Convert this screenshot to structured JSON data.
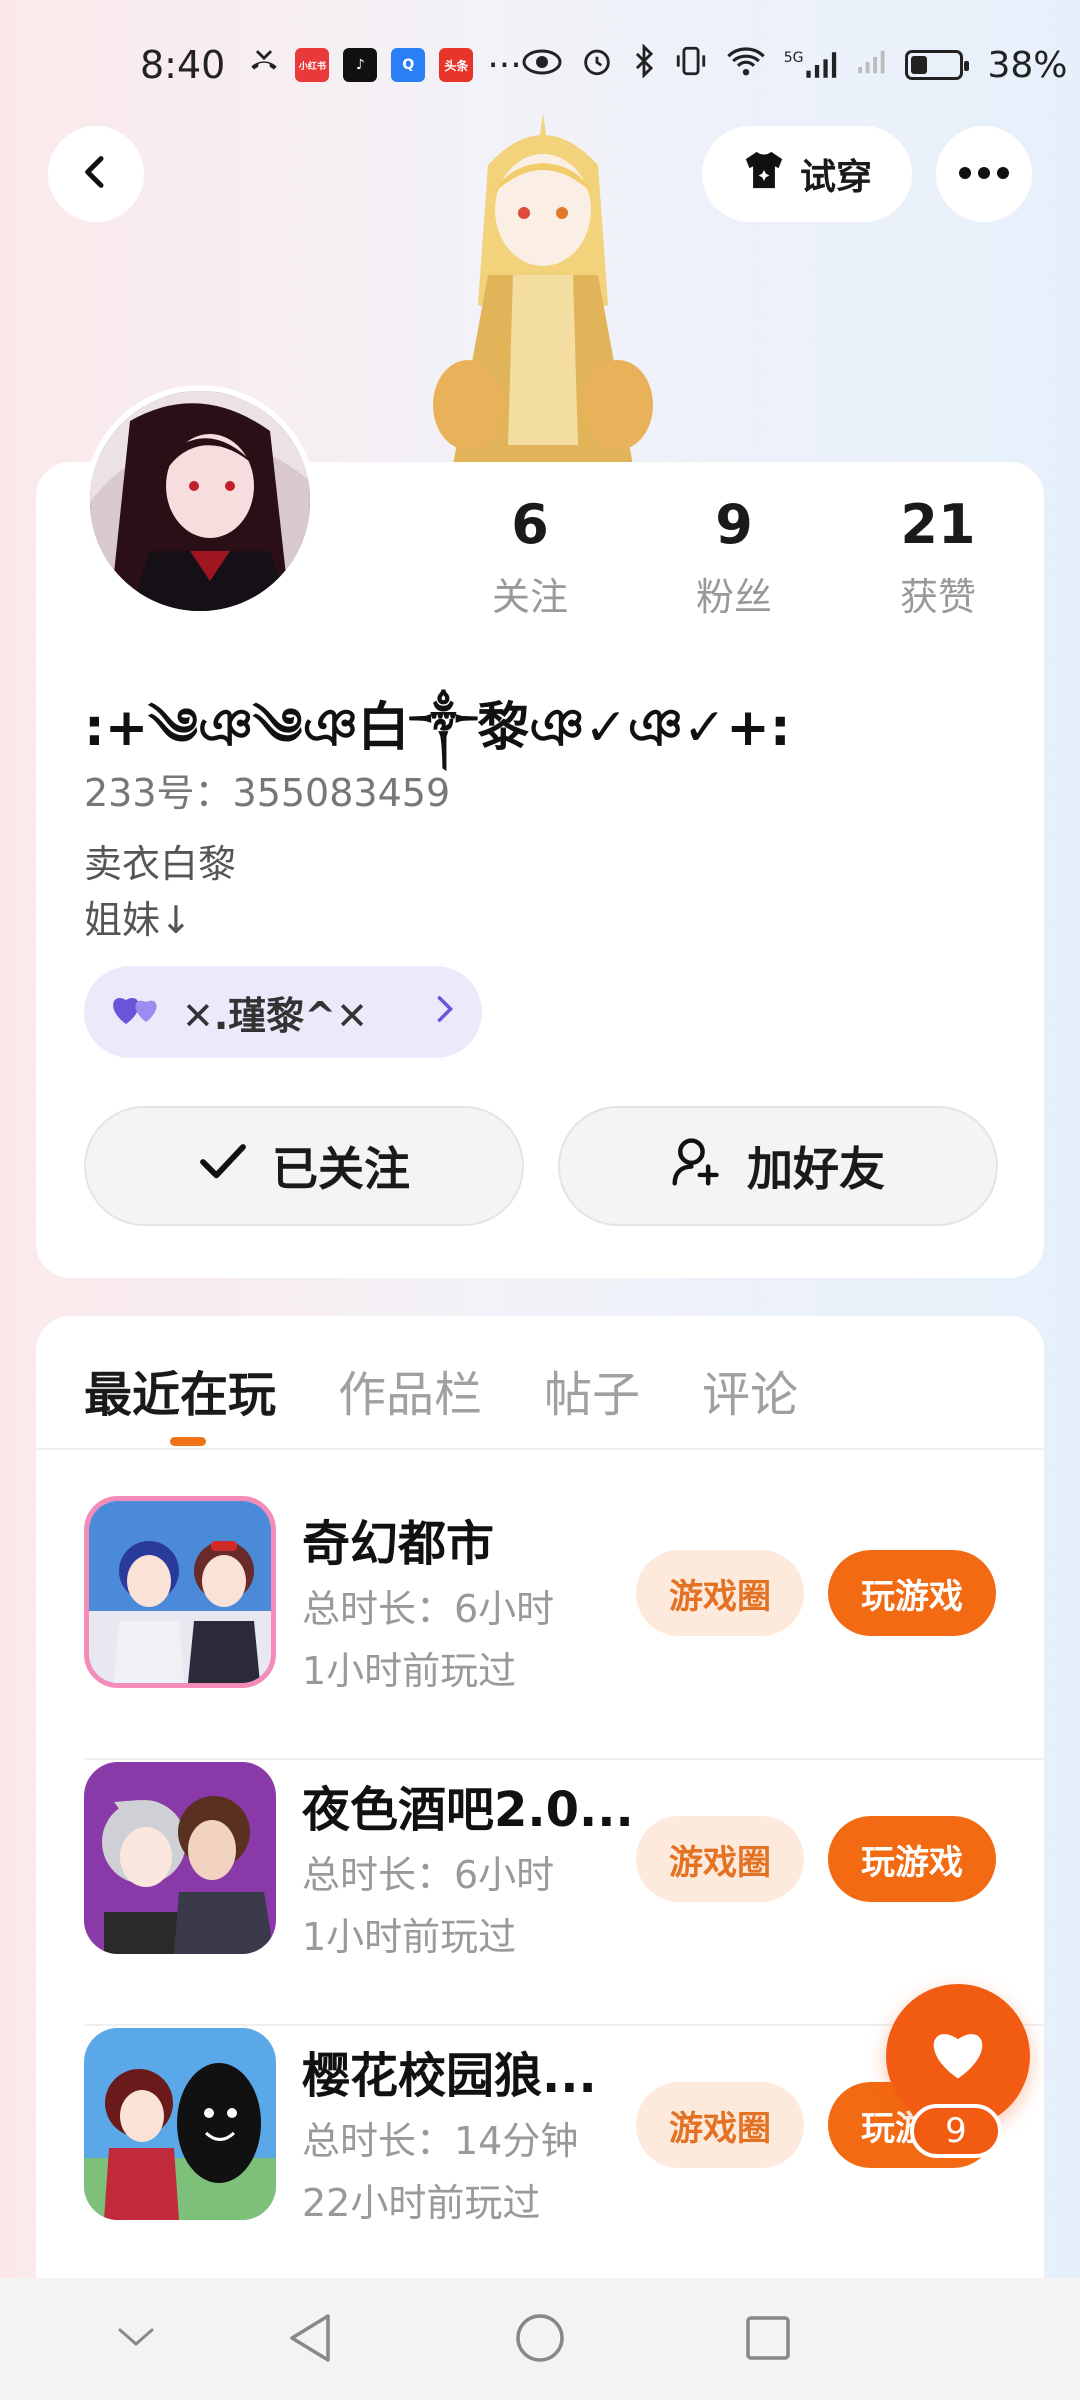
{
  "status_bar": {
    "time": "8:40",
    "more": "···",
    "network": "5G",
    "battery": "38%",
    "notif_icons": [
      {
        "name": "xiaohongshu-icon",
        "label": "小红书",
        "color": "#e83a3a"
      },
      {
        "name": "tiktok-icon",
        "label": "♪",
        "color": "#111111"
      },
      {
        "name": "qq-browser-icon",
        "label": "Q",
        "color": "#2a7ff5"
      },
      {
        "name": "toutiao-icon",
        "label": "头条",
        "color": "#e8352a"
      }
    ]
  },
  "top": {
    "tryon_label": "试穿"
  },
  "profile": {
    "stats": [
      {
        "value": "6",
        "label": "关注"
      },
      {
        "value": "9",
        "label": "粉丝"
      },
      {
        "value": "21",
        "label": "获赞"
      }
    ],
    "nickname": ":+༄ঞ༄ঞ白༒黎ঞ✓ঞ✓+:",
    "id_text": "233号：355083459",
    "bio_line1": "卖衣白黎",
    "bio_line2": "姐妹↓",
    "relation_chip_label": "✕.瑾黎^✕",
    "followed_label": "已关注",
    "add_friend_label": "加好友"
  },
  "tabs": [
    {
      "label": "最近在玩",
      "active": true
    },
    {
      "label": "作品栏",
      "active": false
    },
    {
      "label": "帖子",
      "active": false
    },
    {
      "label": "评论",
      "active": false
    }
  ],
  "games": [
    {
      "title": "奇幻都市",
      "duration": "总时长：6小时",
      "last_played": "1小时前玩过",
      "circle_label": "游戏圈",
      "play_label": "玩游戏"
    },
    {
      "title": "夜色酒吧2.0...",
      "duration": "总时长：6小时",
      "last_played": "1小时前玩过",
      "circle_label": "游戏圈",
      "play_label": "玩游戏"
    },
    {
      "title": "樱花校园狼...",
      "duration": "总时长：14分钟",
      "last_played": "22小时前玩过",
      "circle_label": "游戏圈",
      "play_label": "玩游戏"
    }
  ],
  "like": {
    "count": "9"
  },
  "colors": {
    "accent": "#f26a12",
    "chip_bg": "#fdeadc",
    "relation_purple": "#6a55d8"
  }
}
